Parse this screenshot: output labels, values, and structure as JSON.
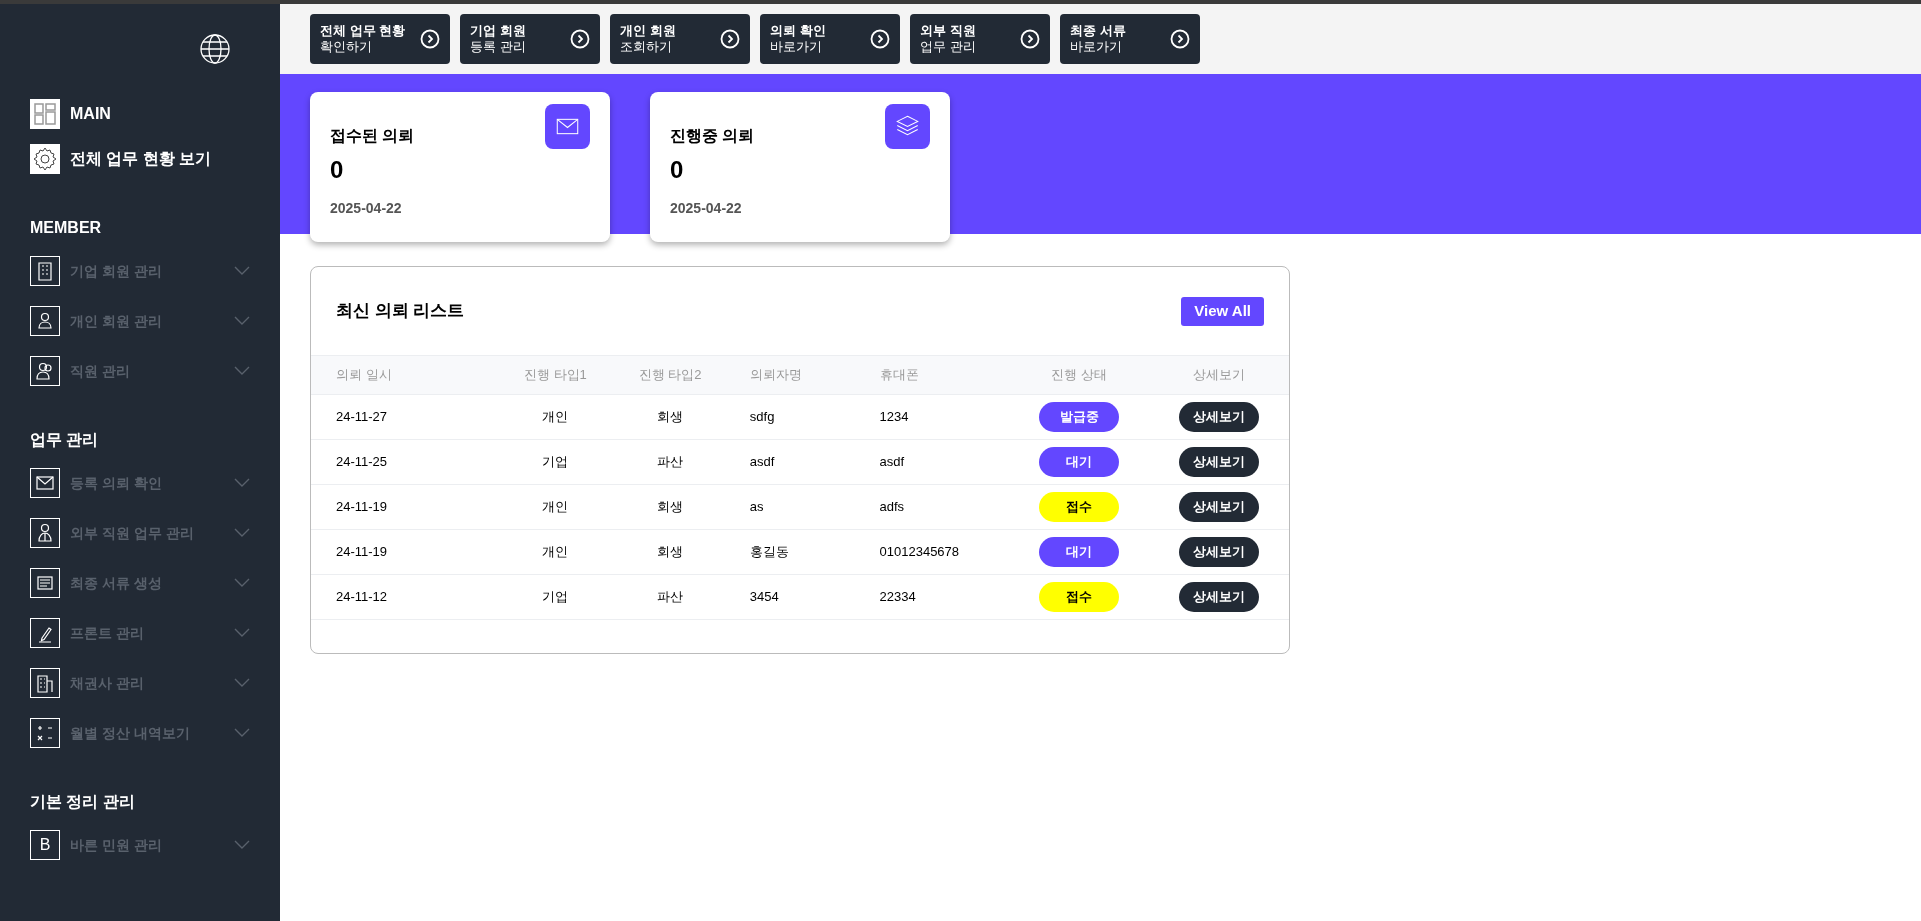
{
  "sidebar": {
    "top_items": [
      {
        "label": "MAIN"
      },
      {
        "label": "전체 업무 현황 보기"
      }
    ],
    "sections": [
      {
        "title": "MEMBER",
        "items": [
          {
            "label": "기업 회원 관리",
            "expanded": false
          },
          {
            "label": "개인 회원 관리",
            "expanded": false
          },
          {
            "label": "직원 관리",
            "expanded": false
          }
        ]
      },
      {
        "title": "업무 관리",
        "items": [
          {
            "label": "등록 의뢰 확인",
            "expanded": false
          },
          {
            "label": "외부 직원 업무 관리",
            "expanded": false
          },
          {
            "label": "최종 서류 생성",
            "expanded": false
          },
          {
            "label": "프론트 관리",
            "expanded": false
          },
          {
            "label": "채권사 관리",
            "expanded": false
          },
          {
            "label": "월별 정산 내역보기",
            "expanded": false
          }
        ]
      },
      {
        "title": "기본 정리 관리",
        "items": [
          {
            "label": "바른 민원 관리",
            "expanded": false,
            "icon_letter": "B"
          }
        ]
      }
    ]
  },
  "shortcuts": [
    {
      "line1": "전체 업무 현황",
      "line2": "확인하기"
    },
    {
      "line1": "기업 회원",
      "line2": "등록 관리"
    },
    {
      "line1": "개인 회원",
      "line2": "조회하기"
    },
    {
      "line1": "의뢰 확인",
      "line2": "바로가기"
    },
    {
      "line1": "외부 직원",
      "line2": "업무 관리"
    },
    {
      "line1": "최종 서류",
      "line2": "바로가기"
    }
  ],
  "stat_cards": [
    {
      "title": "접수된 의뢰",
      "value": "0",
      "date": "2025-04-22",
      "kind": "mail"
    },
    {
      "title": "진행중 의뢰",
      "value": "0",
      "date": "2025-04-22",
      "kind": "layers"
    }
  ],
  "recent_list": {
    "title": "최신 의뢰 리스트",
    "view_all": "View All",
    "columns": [
      "의뢰 일시",
      "진행 타입1",
      "진행 타입2",
      "의뢰자명",
      "휴대폰",
      "진행 상태",
      "상세보기"
    ],
    "rows": [
      {
        "date": "24-11-27",
        "type1": "개인",
        "type2": "회생",
        "name": "sdfg",
        "phone": "1234",
        "status": "발급중",
        "color": "#6347ff",
        "detail": "상세보기"
      },
      {
        "date": "24-11-25",
        "type1": "기업",
        "type2": "파산",
        "name": "asdf",
        "phone": "asdf",
        "status": "대기",
        "color": "#6347ff",
        "detail": "상세보기"
      },
      {
        "date": "24-11-19",
        "type1": "개인",
        "type2": "회생",
        "name": "as",
        "phone": "adfs",
        "status": "접수",
        "color": "#ffff00",
        "detail": "상세보기"
      },
      {
        "date": "24-11-19",
        "type1": "개인",
        "type2": "회생",
        "name": "홍길동",
        "phone": "01012345678",
        "status": "대기",
        "color": "#6347ff",
        "detail": "상세보기"
      },
      {
        "date": "24-11-12",
        "type1": "기업",
        "type2": "파산",
        "name": "3454",
        "phone": "22334",
        "status": "접수",
        "color": "#ffff00",
        "detail": "상세보기"
      }
    ]
  }
}
